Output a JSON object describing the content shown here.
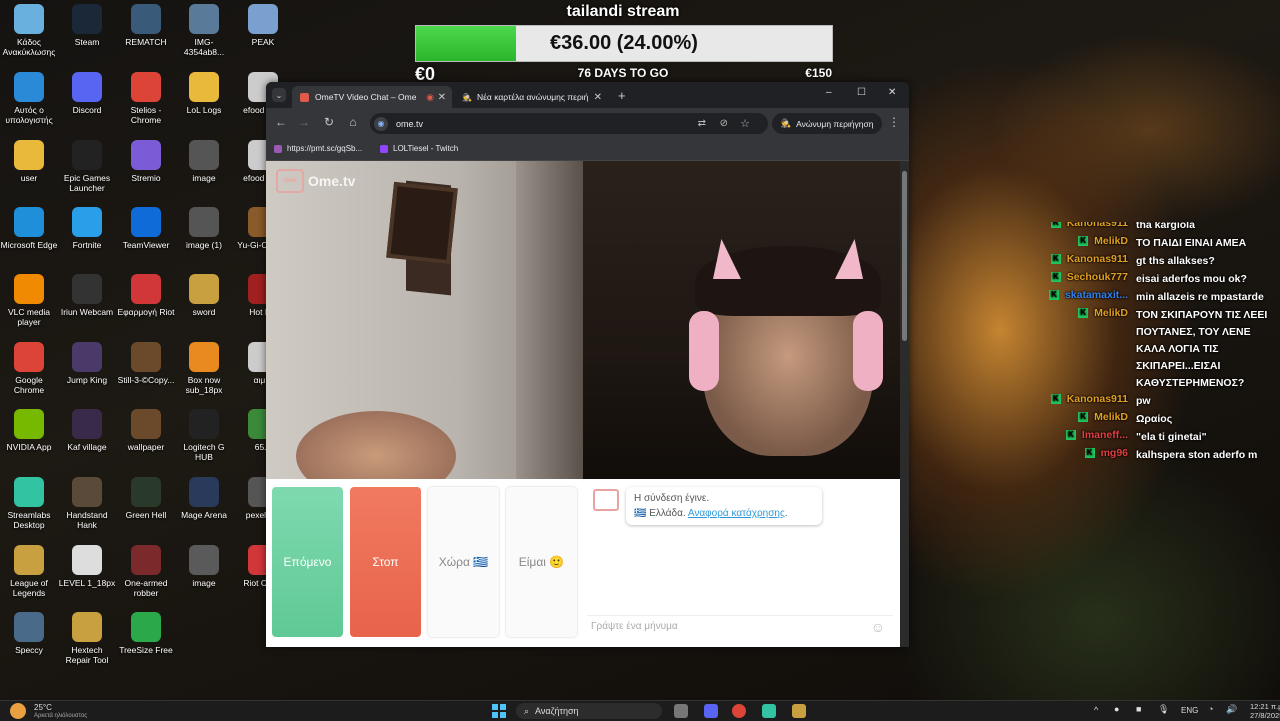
{
  "desktop": {
    "icons": [
      {
        "label": "Κάδος Ανακύκλωσης",
        "icon": "recycle-bin-icon",
        "color": "#6ab0de"
      },
      {
        "label": "Steam",
        "icon": "steam-icon",
        "color": "#1b2838"
      },
      {
        "label": "REMATCH",
        "icon": "rematch-icon",
        "color": "#3a5a7a"
      },
      {
        "label": "IMG-4354ab8...",
        "icon": "image-file-icon",
        "color": "#5a7a9a"
      },
      {
        "label": "PEAK",
        "icon": "peak-icon",
        "color": "#7aa0d0"
      },
      {
        "label": "Αυτός ο υπολογιστής",
        "icon": "computer-icon",
        "color": "#2a8ad8"
      },
      {
        "label": "Discord",
        "icon": "discord-icon",
        "color": "#5865f2"
      },
      {
        "label": "Stelios - Chrome",
        "icon": "chrome-icon",
        "color": "#db4437"
      },
      {
        "label": "LoL Logs",
        "icon": "folder-icon",
        "color": "#e8b93a"
      },
      {
        "label": "efood su...",
        "icon": "file-icon",
        "color": "#cccccc"
      },
      {
        "label": "user",
        "icon": "folder-icon",
        "color": "#e8b93a"
      },
      {
        "label": "Epic Games Launcher",
        "icon": "epic-games-icon",
        "color": "#222222"
      },
      {
        "label": "Stremio",
        "icon": "stremio-icon",
        "color": "#7b5bd6"
      },
      {
        "label": "image",
        "icon": "image-file-icon",
        "color": "#555555"
      },
      {
        "label": "efood su...",
        "icon": "file-icon",
        "color": "#cccccc"
      },
      {
        "label": "Microsoft Edge",
        "icon": "edge-icon",
        "color": "#1e8fd8"
      },
      {
        "label": "Fortnite",
        "icon": "fortnite-icon",
        "color": "#2a9ee8"
      },
      {
        "label": "TeamViewer",
        "icon": "teamviewer-icon",
        "color": "#0e6bd8"
      },
      {
        "label": "image (1)",
        "icon": "image-file-icon",
        "color": "#555555"
      },
      {
        "label": "Yu-Gi-O... Lin",
        "icon": "yugioh-icon",
        "color": "#8a5a2a"
      },
      {
        "label": "VLC media player",
        "icon": "vlc-icon",
        "color": "#f08a00"
      },
      {
        "label": "Iriun Webcam",
        "icon": "webcam-icon",
        "color": "#333333"
      },
      {
        "label": "Εφαρμογή Riot",
        "icon": "riot-icon",
        "color": "#d13639"
      },
      {
        "label": "sword",
        "icon": "sword-icon",
        "color": "#c8a040"
      },
      {
        "label": "Hot L...",
        "icon": "game-icon",
        "color": "#a02020"
      },
      {
        "label": "Google Chrome",
        "icon": "chrome-icon",
        "color": "#db4437"
      },
      {
        "label": "Jump King",
        "icon": "jump-king-icon",
        "color": "#4a3a6a"
      },
      {
        "label": "Still-3-©Copy...",
        "icon": "image-file-icon",
        "color": "#6a4a2a"
      },
      {
        "label": "Box now sub_18px",
        "icon": "box-icon",
        "color": "#e88a20"
      },
      {
        "label": "αιμ...",
        "icon": "file-icon",
        "color": "#cccccc"
      },
      {
        "label": "NVIDIA App",
        "icon": "nvidia-icon",
        "color": "#76b900"
      },
      {
        "label": "Kaf village",
        "icon": "image-file-icon",
        "color": "#3a2a4a"
      },
      {
        "label": "wallpaper",
        "icon": "image-file-icon",
        "color": "#6a4a2a"
      },
      {
        "label": "Logitech G HUB",
        "icon": "logitech-icon",
        "color": "#222222"
      },
      {
        "label": "65...",
        "icon": "file-icon",
        "color": "#3a8a3a"
      },
      {
        "label": "Streamlabs Desktop",
        "icon": "streamlabs-icon",
        "color": "#31c3a2"
      },
      {
        "label": "Handstand Hank",
        "icon": "game-icon",
        "color": "#5a4a3a"
      },
      {
        "label": "Green Hell",
        "icon": "game-icon",
        "color": "#2a3a2a"
      },
      {
        "label": "Mage Arena",
        "icon": "game-icon",
        "color": "#2a3a5a"
      },
      {
        "label": "pexels-...",
        "icon": "image-file-icon",
        "color": "#555555"
      },
      {
        "label": "League of Legends",
        "icon": "lol-icon",
        "color": "#c8a040"
      },
      {
        "label": "LEVEL 1_18px",
        "icon": "file-icon",
        "color": "#dddddd"
      },
      {
        "label": "One-armed robber",
        "icon": "game-icon",
        "color": "#7a2a2a"
      },
      {
        "label": "image",
        "icon": "image-file-icon",
        "color": "#5a5a5a"
      },
      {
        "label": "Riot Client",
        "icon": "riot-icon",
        "color": "#d13639"
      },
      {
        "label": "Speccy",
        "icon": "speccy-icon",
        "color": "#4a6a8a"
      },
      {
        "label": "Hextech Repair Tool",
        "icon": "hextech-icon",
        "color": "#c8a040"
      },
      {
        "label": "TreeSize Free",
        "icon": "treesize-icon",
        "color": "#2aa84a"
      }
    ]
  },
  "stream": {
    "title": "tailandi stream",
    "goal_text": "€36.00 (24.00%)",
    "goal_fraction": 0.24,
    "min_label": "€0",
    "days_label": "76 DAYS TO GO",
    "max_label": "€150"
  },
  "browser": {
    "tabs": [
      {
        "label": "OmeTV Video Chat – Ome",
        "active": true,
        "fav_color": "#e05a4a"
      },
      {
        "label": "Νέα καρτέλα ανώνυμης περιή",
        "active": false,
        "fav_color": "#999999"
      }
    ],
    "url": "ome.tv",
    "incognito_label": "Ανώνυμη περιήγηση",
    "bookmarks": [
      {
        "label": "https://pmt.sc/gqSb...",
        "fav_color": "#9b59b6"
      },
      {
        "label": "LOLTiesel - Twitch",
        "fav_color": "#9146ff"
      }
    ],
    "window_controls": {
      "minimize": "–",
      "maximize": "☐",
      "close": "✕"
    }
  },
  "ometv": {
    "logo_text": "Ome.tv",
    "buttons": {
      "next": "Επόμενο",
      "stop": "Στοπ",
      "country": "Χώρα",
      "country_flag": "🇬🇷",
      "gender": "Είμαι",
      "gender_emoji": "🙂"
    },
    "chat": {
      "system_message": "Η σύνδεση έγινε.",
      "country_line": "Ελλάδα.",
      "report_link": "Αναφορά κατάχρησης",
      "input_placeholder": "Γράψτε ένα μήνυμα"
    }
  },
  "twitch_chat": [
    {
      "user": "Kanonas911",
      "user_color": "#e0a020",
      "text": "tha kargiola",
      "partial": true
    },
    {
      "user": "MelikD",
      "user_color": "#e0a020",
      "text": "ΤΟ ΠΑΙΔΙ ΕΙΝΑΙ ΑΜΕΑ"
    },
    {
      "user": "Kanonas911",
      "user_color": "#e0a020",
      "text": "gt ths allakses?"
    },
    {
      "user": "Sechouk777",
      "user_color": "#e0a020",
      "text": "eisai aderfos mou ok?"
    },
    {
      "user": "skatamaxit...",
      "user_color": "#2f80ed",
      "text": "min allazeis re mpastarde"
    },
    {
      "user": "MelikD",
      "user_color": "#e0a020",
      "text": "ΤΟΝ ΣΚΙΠΑΡΟΥΝ ΤΙΣ ΛΕΕΙ ΠΟΥΤΑΝΕΣ, ΤΟΥ ΛΕΝΕ ΚΑΛΑ ΛΟΓΙΑ ΤΙΣ ΣΚΙΠΑΡΕΙ...ΕΙΣΑΙ ΚΑΘΥΣΤΕΡΗΜΕΝΟΣ?"
    },
    {
      "user": "Kanonas911",
      "user_color": "#e0a020",
      "text": "pw"
    },
    {
      "user": "MelikD",
      "user_color": "#e0a020",
      "text": "Ωραίος"
    },
    {
      "user": "Imaneff...",
      "user_color": "#e04040",
      "text": "\"ela ti ginetai\""
    },
    {
      "user": "mg96",
      "user_color": "#e04040",
      "text": "kalhspera ston aderfo m"
    }
  ],
  "taskbar": {
    "weather_temp": "25°C",
    "weather_desc": "Αρκετά ηλιόλουστος",
    "search_placeholder": "Αναζήτηση",
    "language": "ENG",
    "time": "12:21 π.μ.",
    "date": "27/8/2025"
  }
}
